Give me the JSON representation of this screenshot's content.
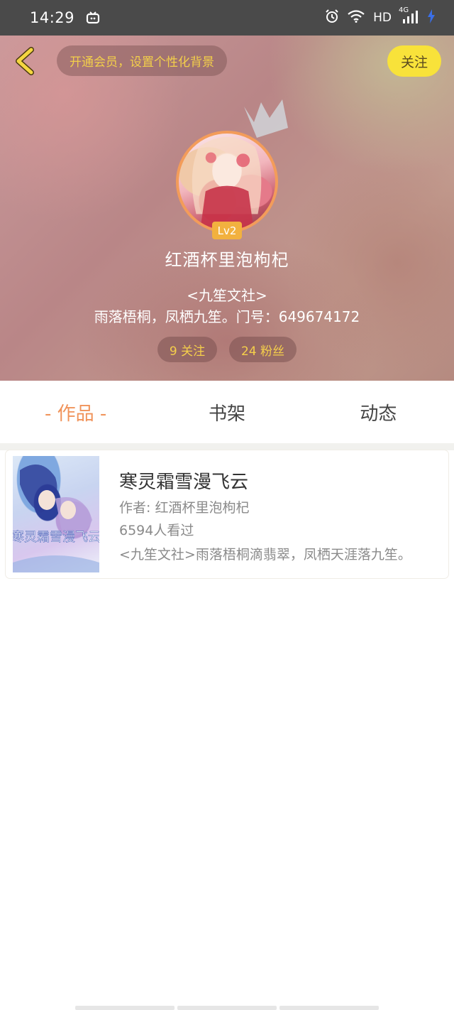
{
  "status_bar": {
    "time": "14:29",
    "network": "HD",
    "signal": "4G"
  },
  "header": {
    "vip_prompt": "开通会员，设置个性化背景",
    "follow_label": "关注"
  },
  "profile": {
    "level": "Lv2",
    "username": "红酒杯里泡枸杞",
    "bio_line1": "<九笙文社>",
    "bio_line2": "雨落梧桐，凤栖九笙。门号：649674172",
    "following": "9 关注",
    "fans": "24 粉丝"
  },
  "tabs": [
    {
      "label": "- 作品 -",
      "active": true
    },
    {
      "label": "书架",
      "active": false
    },
    {
      "label": "动态",
      "active": false
    }
  ],
  "books": [
    {
      "title": "寒灵霜雪漫飞云",
      "author": "作者: 红酒杯里泡枸杞",
      "views": "6594人看过",
      "description": "<九笙文社>雨落梧桐滴翡翠，凤栖天涯落九笙。",
      "cover_text": "寒灵霜雪漫飞云"
    }
  ],
  "colors": {
    "accent_orange": "#f0935a",
    "follow_yellow": "#f8e23a",
    "vip_text": "#f3cf4a",
    "level_badge": "#f2b13f",
    "status_bar": "#4a4a4a"
  },
  "icons": [
    "back-chevron-icon",
    "tv-icon",
    "alarm-icon",
    "wifi-icon",
    "signal-icon",
    "charging-icon",
    "crown-icon"
  ]
}
